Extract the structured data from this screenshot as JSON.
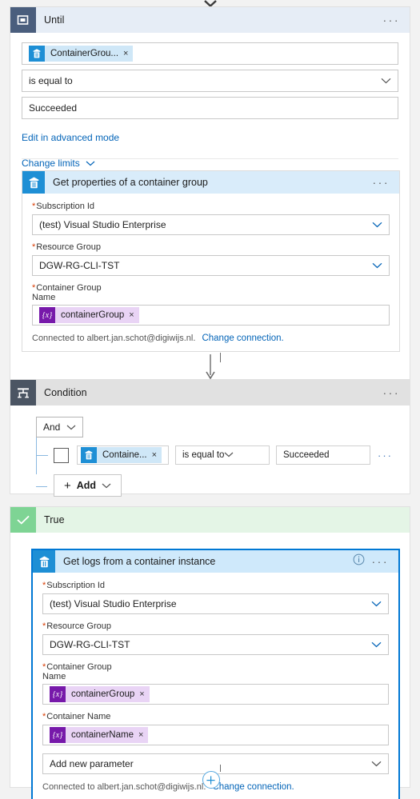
{
  "canvas": {
    "top_collapse_icon": "chevron-down-icon",
    "bottom_add_icon": "plus-circle-icon"
  },
  "until_scope": {
    "title": "Until",
    "icon": "until-loop-icon",
    "more_label": "···",
    "token": {
      "icon": "azure-container-instance-icon",
      "label": "ContainerGrou...",
      "remove_label": "×"
    },
    "operator": {
      "value": "is equal to",
      "icon": "chevron-down-icon"
    },
    "value": "Succeeded",
    "advanced_link": "Edit in advanced mode",
    "change_limits_link": "Change limits",
    "change_limits_icon": "chevron-down-icon"
  },
  "get_properties_card": {
    "title": "Get properties of a container group",
    "icon": "azure-container-instance-icon",
    "more_label": "···",
    "fields": [
      {
        "label": "Subscription Id",
        "required": "*",
        "value": "(test) Visual Studio Enterprise",
        "icon": "chevron-down-icon"
      },
      {
        "label": "Resource Group",
        "required": "*",
        "value": "DGW-RG-CLI-TST",
        "icon": "chevron-down-icon"
      }
    ],
    "container_group": {
      "label_line1": "Container Group",
      "label_line2": "Name",
      "required": "*",
      "token": {
        "icon": "expression-icon",
        "glyph": "{x}",
        "label": "containerGroup",
        "remove_label": "×"
      }
    },
    "connection_text": "Connected to albert.jan.schot@digiwijs.nl.",
    "connection_link": "Change connection."
  },
  "condition_scope": {
    "title": "Condition",
    "icon": "condition-branch-icon",
    "more_label": "···",
    "logical_operator": {
      "value": "And",
      "icon": "chevron-down-icon"
    },
    "row": {
      "checkbox": false,
      "token": {
        "icon": "azure-container-instance-icon",
        "label": "Containe...",
        "remove_label": "×"
      },
      "operator": {
        "value": "is equal to",
        "icon": "chevron-down-icon"
      },
      "value": "Succeeded",
      "more_label": "···"
    },
    "add_button": {
      "label": "Add",
      "plus": "+",
      "icon": "chevron-down-icon"
    }
  },
  "true_scope": {
    "title": "True",
    "icon": "check-icon"
  },
  "get_logs_card": {
    "title": "Get logs from a container instance",
    "icon": "azure-container-instance-icon",
    "info_label": "i",
    "info_icon": "info-circle-icon",
    "more_label": "···",
    "fields": [
      {
        "label": "Subscription Id",
        "required": "*",
        "value": "(test) Visual Studio Enterprise",
        "icon": "chevron-down-icon"
      },
      {
        "label": "Resource Group",
        "required": "*",
        "value": "DGW-RG-CLI-TST",
        "icon": "chevron-down-icon"
      }
    ],
    "container_group": {
      "label_line1": "Container Group",
      "label_line2": "Name",
      "required": "*",
      "token": {
        "icon": "expression-icon",
        "glyph": "{x}",
        "label": "containerGroup",
        "remove_label": "×"
      }
    },
    "container_name": {
      "label": "Container Name",
      "required": "*",
      "token": {
        "icon": "expression-icon",
        "glyph": "{x}",
        "label": "containerName",
        "remove_label": "×"
      }
    },
    "add_parameter": {
      "value": "Add new parameter",
      "icon": "chevron-down-icon"
    },
    "connection_text": "Connected to albert.jan.schot@digiwijs.nl.",
    "connection_link": "Change connection."
  },
  "colors": {
    "accent": "#0078d4",
    "aci_blue": "#1e8fd5",
    "expression_purple": "#7719aa",
    "true_green": "#7ed494",
    "until_header": "#e6edf6",
    "condition_header": "#e1e1e1",
    "true_header": "#e4f5e6",
    "required_red": "#d83b01"
  }
}
